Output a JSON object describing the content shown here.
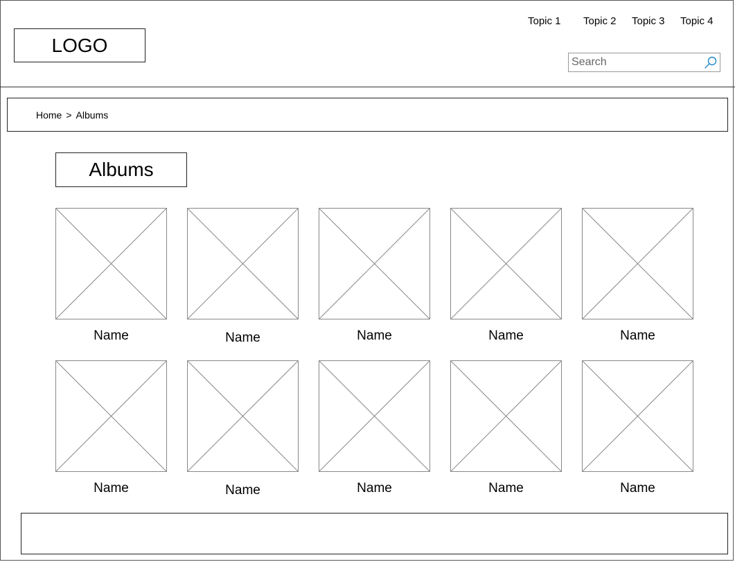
{
  "header": {
    "logo_text": "LOGO",
    "nav": [
      {
        "label": "Topic 1"
      },
      {
        "label": "Topic 2"
      },
      {
        "label": "Topic 3"
      },
      {
        "label": "Topic 4"
      }
    ],
    "search": {
      "placeholder": "Search",
      "value": "",
      "icon": "search-icon"
    }
  },
  "breadcrumb": {
    "items": [
      {
        "label": "Home"
      },
      {
        "label": "Albums"
      }
    ],
    "separator": ">"
  },
  "page": {
    "title": "Albums"
  },
  "albums": [
    {
      "name": "Name"
    },
    {
      "name": "Name"
    },
    {
      "name": "Name"
    },
    {
      "name": "Name"
    },
    {
      "name": "Name"
    },
    {
      "name": "Name"
    },
    {
      "name": "Name"
    },
    {
      "name": "Name"
    },
    {
      "name": "Name"
    },
    {
      "name": "Name"
    }
  ],
  "colors": {
    "search_icon": "#1e88c8",
    "placeholder_stroke": "#888888"
  }
}
